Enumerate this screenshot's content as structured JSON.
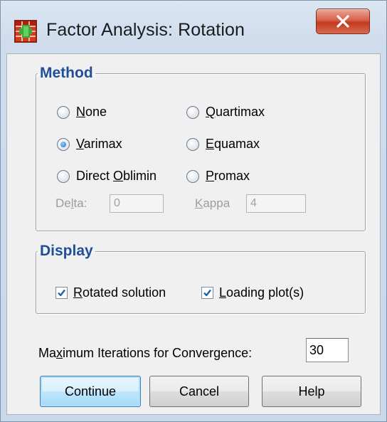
{
  "window": {
    "title": "Factor Analysis: Rotation"
  },
  "method": {
    "legend": "Method",
    "options": [
      {
        "label": "None",
        "selected": false
      },
      {
        "label": "Quartimax",
        "selected": false
      },
      {
        "label": "Varimax",
        "selected": true
      },
      {
        "label": "Equamax",
        "selected": false
      },
      {
        "label": "Direct Oblimin",
        "selected": false
      },
      {
        "label": "Promax",
        "selected": false
      }
    ],
    "delta_label": "Delta:",
    "delta_value": "0",
    "kappa_label": "Kappa",
    "kappa_value": "4"
  },
  "display": {
    "legend": "Display",
    "rotated_solution": {
      "label": "Rotated solution",
      "checked": true
    },
    "loading_plots": {
      "label": "Loading plot(s)",
      "checked": true
    }
  },
  "iterations": {
    "label": "Maximum Iterations for Convergence:",
    "value": "30"
  },
  "buttons": {
    "continue": "Continue",
    "cancel": "Cancel",
    "help": "Help"
  },
  "colors": {
    "legend_text": "#1f4f9a",
    "close_button": "#c3391f",
    "radio_dot": "#1f6fc4",
    "checkmark": "#1f5fae"
  },
  "icons": {
    "app": "spss-table-icon",
    "close": "close-x-icon",
    "check": "checkmark-icon"
  }
}
